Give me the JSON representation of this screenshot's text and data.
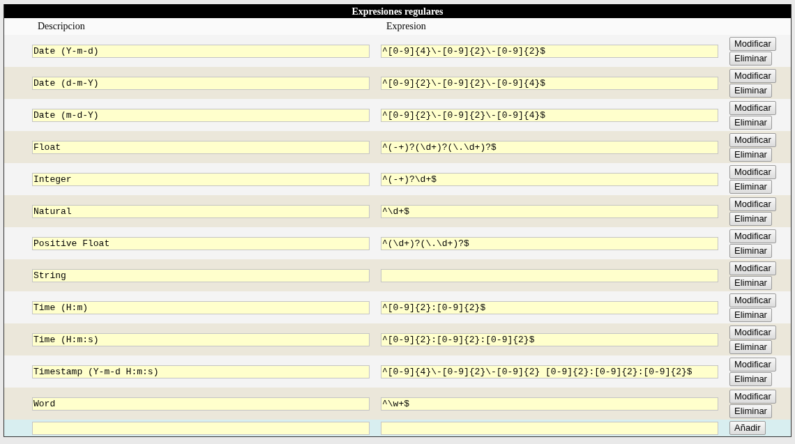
{
  "title": "Expresiones regulares",
  "columns": [
    "Descripcion",
    "Expresion"
  ],
  "rows": [
    {
      "description": "Date (Y-m-d)",
      "expression": "^[0-9]{4}\\-[0-9]{2}\\-[0-9]{2}$",
      "buttons": [
        "Modificar",
        "Eliminar"
      ]
    },
    {
      "description": "Date (d-m-Y)",
      "expression": "^[0-9]{2}\\-[0-9]{2}\\-[0-9]{4}$",
      "buttons": [
        "Modificar",
        "Eliminar"
      ]
    },
    {
      "description": "Date (m-d-Y)",
      "expression": "^[0-9]{2}\\-[0-9]{2}\\-[0-9]{4}$",
      "buttons": [
        "Modificar",
        "Eliminar"
      ]
    },
    {
      "description": "Float",
      "expression": "^(-+)?(\\d+)?(\\.\\d+)?$",
      "buttons": [
        "Modificar",
        "Eliminar"
      ]
    },
    {
      "description": "Integer",
      "expression": "^(-+)?\\d+$",
      "buttons": [
        "Modificar",
        "Eliminar"
      ]
    },
    {
      "description": "Natural",
      "expression": "^\\d+$",
      "buttons": [
        "Modificar",
        "Eliminar"
      ]
    },
    {
      "description": "Positive Float",
      "expression": "^(\\d+)?(\\.\\d+)?$",
      "buttons": [
        "Modificar",
        "Eliminar"
      ]
    },
    {
      "description": "String",
      "expression": "",
      "buttons": [
        "Modificar",
        "Eliminar"
      ]
    },
    {
      "description": "Time (H:m)",
      "expression": "^[0-9]{2}:[0-9]{2}$",
      "buttons": [
        "Modificar",
        "Eliminar"
      ]
    },
    {
      "description": "Time (H:m:s)",
      "expression": "^[0-9]{2}:[0-9]{2}:[0-9]{2}$",
      "buttons": [
        "Modificar",
        "Eliminar"
      ]
    },
    {
      "description": "Timestamp (Y-m-d H:m:s)",
      "expression": "^[0-9]{4}\\-[0-9]{2}\\-[0-9]{2} [0-9]{2}:[0-9]{2}:[0-9]{2}$",
      "buttons": [
        "Modificar",
        "Eliminar"
      ]
    },
    {
      "description": "Word",
      "expression": "^\\w+$",
      "buttons": [
        "Modificar",
        "Eliminar"
      ]
    }
  ],
  "new_row": {
    "button": "Añadir"
  }
}
